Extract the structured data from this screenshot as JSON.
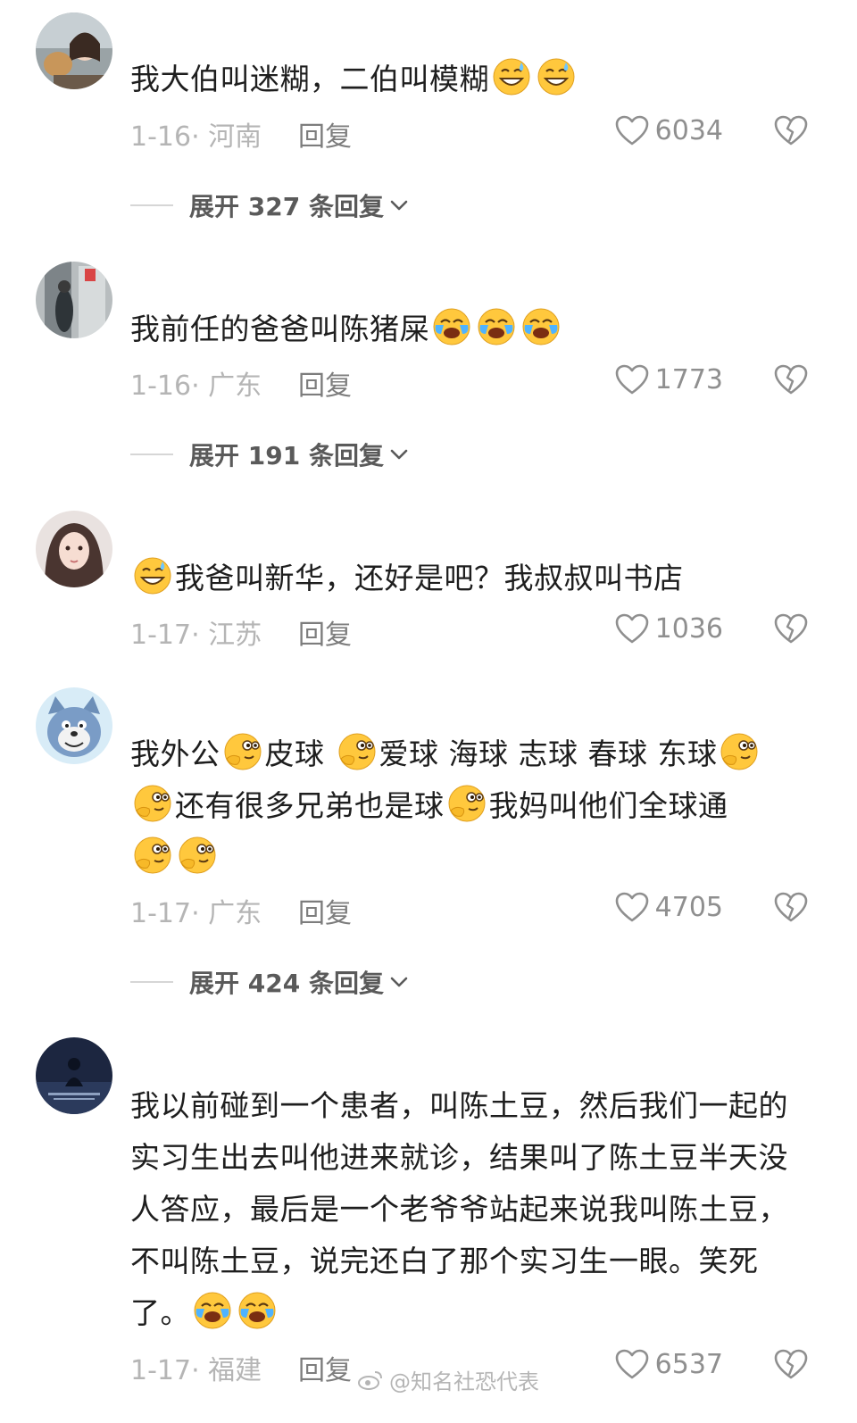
{
  "comments": [
    {
      "text_parts": [
        "我大伯叫迷糊，二伯叫模糊"
      ],
      "date": "1-16",
      "location": "河南",
      "reply_label": "回复",
      "likes": "6034",
      "expand": "展开 327 条回复"
    },
    {
      "text_parts": [
        "我前任的爸爸叫陈猪屎"
      ],
      "date": "1-16",
      "location": "广东",
      "reply_label": "回复",
      "likes": "1773",
      "expand": "展开 191 条回复"
    },
    {
      "text_parts": [
        "我爸叫新华，还好是吧？我叔叔叫书店"
      ],
      "date": "1-17",
      "location": "江苏",
      "reply_label": "回复",
      "likes": "1036"
    },
    {
      "text_parts": [
        "我外公",
        "皮球",
        "爱球 海球 志球 春球 东球",
        "还有很多兄弟也是球",
        "我妈叫他们全球通"
      ],
      "date": "1-17",
      "location": "广东",
      "reply_label": "回复",
      "likes": "4705",
      "expand": "展开 424 条回复"
    },
    {
      "text_parts": [
        "我以前碰到一个患者，叫陈土豆，然后我们一起的实习生出去叫他进来就诊，结果叫了陈土豆半天没人答应，最后是一个老爷爷站起来说我叫陈土豆，不叫陈土豆，说完还白了那个实习生一眼。笑死了。"
      ],
      "date": "1-17",
      "location": "福建",
      "reply_label": "回复",
      "likes": "6537"
    }
  ],
  "watermark": "@知名社恐代表",
  "icons": {
    "like": "heart-outline-icon",
    "dislike": "broken-heart-icon",
    "expand": "chevron-down-icon",
    "emoji_grin": "grinning-sweat-emoji",
    "emoji_cry": "crying-laughing-emoji",
    "emoji_think": "thinking-emoji"
  },
  "colors": {
    "text": "#1e1e1e",
    "meta": "#b5b5b5",
    "reply": "#7d7d7d",
    "emoji": "#ffc83d"
  }
}
